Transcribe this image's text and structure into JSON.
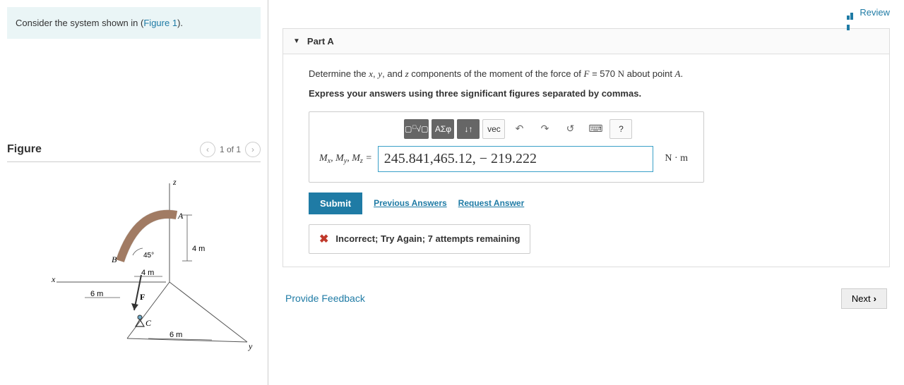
{
  "problem": {
    "text_before": "Consider the system shown in (",
    "link_text": "Figure 1",
    "text_after": ")."
  },
  "figure": {
    "title": "Figure",
    "pager": "1 of 1",
    "labels": {
      "z": "z",
      "x": "x",
      "y": "y",
      "A": "A",
      "B": "B",
      "C": "C",
      "F": "F",
      "angle": "45°",
      "dim4mA": "4 m",
      "dim4mB": "4 m",
      "dim6mA": "6 m",
      "dim6mB": "6 m"
    }
  },
  "review": "Review",
  "part": {
    "title": "Part A",
    "question_parts": {
      "p1": "Determine the ",
      "p2": ", ",
      "p3": ", and ",
      "p4": " components of the moment of the force of ",
      "p5": " about point ",
      "p6": "."
    },
    "vars": {
      "x": "x",
      "y": "y",
      "z": "z",
      "F": "F",
      "eq": " = 570 ",
      "N": "N",
      "A": "A"
    },
    "instruction": "Express your answers using three significant figures separated by commas.",
    "toolbar": {
      "templates": "▢√▢",
      "greek": "ΑΣφ",
      "updown": "↓↑",
      "vec": "vec",
      "undo": "↶",
      "redo": "↷",
      "reset": "↺",
      "keyboard": "⌨",
      "help": "?"
    },
    "answer": {
      "label_mx": "M",
      "sx": "x",
      "label_my": "M",
      "sy": "y",
      "label_mz": "M",
      "sz": "z",
      "eq": " = ",
      "value": "245.841,465.12, − 219.222",
      "unit": "N · m"
    },
    "submit": "Submit",
    "prev_answers": "Previous Answers",
    "request": "Request Answer",
    "feedback": "Incorrect; Try Again; 7 attempts remaining"
  },
  "bottom": {
    "provide": "Provide Feedback",
    "next": "Next"
  }
}
